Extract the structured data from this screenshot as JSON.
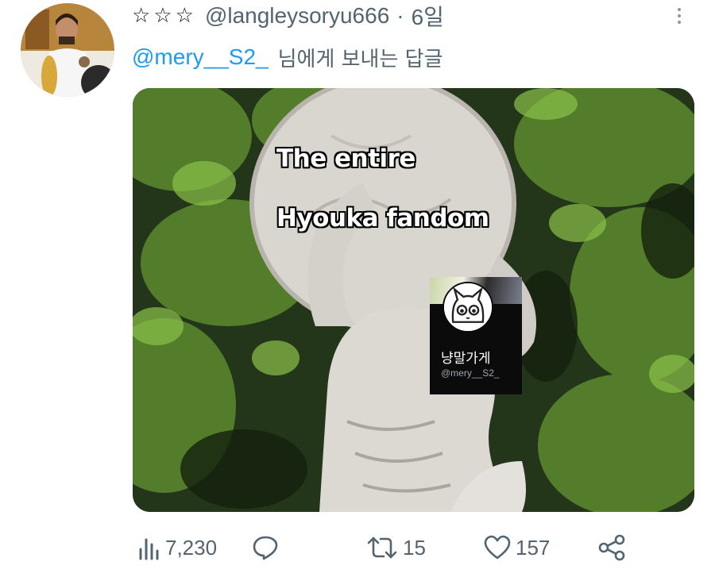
{
  "tweet": {
    "author_name": "☆☆☆",
    "author_handle": "@langleysoryu666",
    "separator": "·",
    "time": "6일",
    "reply_mention": "@mery__S2_",
    "reply_suffix": "님에게 보내는 답글"
  },
  "media": {
    "caption_line1": "The entire",
    "caption_line2": "Hyouka fandom",
    "card_display_name": "냥말가게",
    "card_handle": "@mery__S2_"
  },
  "actions": {
    "views": "7,230",
    "replies": "",
    "retweets": "15",
    "likes": "157"
  }
}
